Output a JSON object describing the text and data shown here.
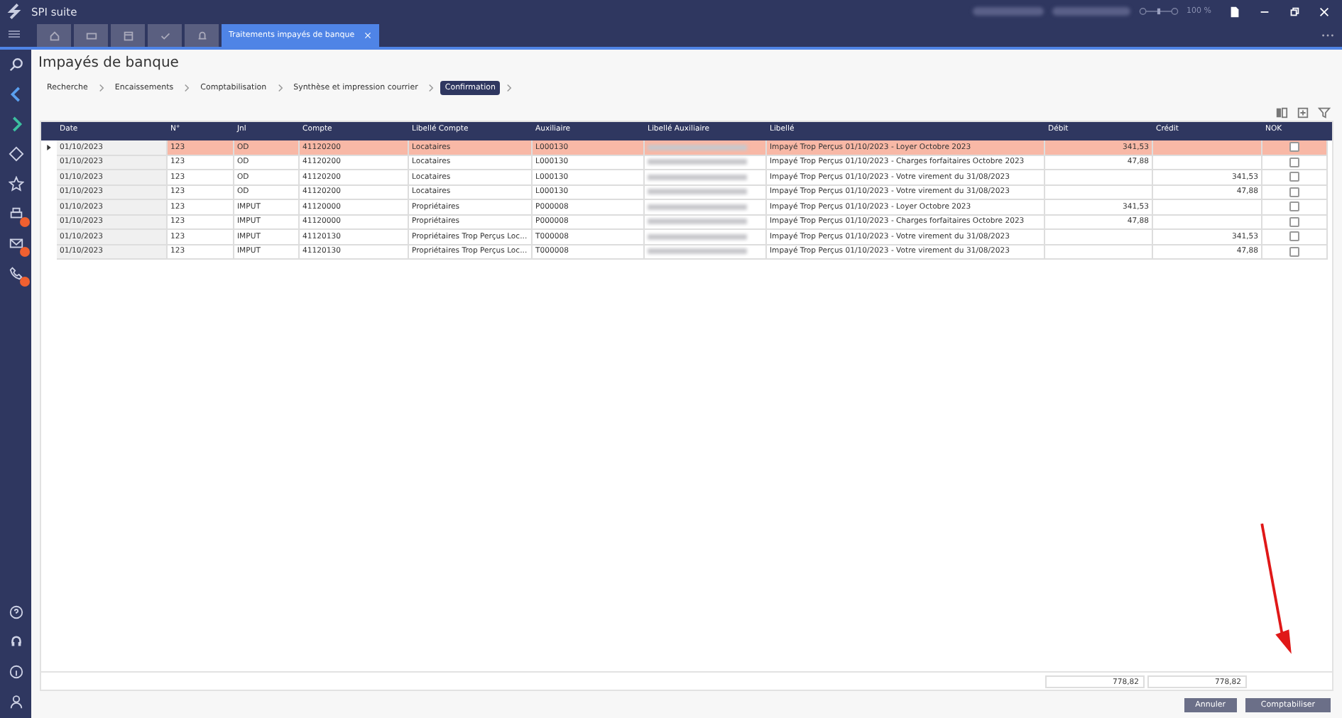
{
  "app": {
    "title": "SPI suite",
    "zoom": "100 %",
    "zoom_slider": {
      "level": 0.5
    }
  },
  "tabs": [
    {
      "kind": "home",
      "selected": false
    },
    {
      "kind": "card",
      "selected": false
    },
    {
      "kind": "calendar",
      "selected": false
    },
    {
      "kind": "check",
      "selected": false
    },
    {
      "kind": "bell",
      "selected": false
    },
    {
      "kind": "text",
      "label": "Traitements impayés de banque",
      "selected": true
    }
  ],
  "sidebar": [
    {
      "kind": "search",
      "badge": false
    },
    {
      "kind": "back",
      "badge": false
    },
    {
      "kind": "forward",
      "badge": false
    },
    {
      "kind": "diamond",
      "badge": false
    },
    {
      "kind": "star",
      "badge": false
    },
    {
      "kind": "printer",
      "badge": true
    },
    {
      "kind": "mail",
      "badge": true
    },
    {
      "kind": "phone",
      "badge": true
    }
  ],
  "sidebar_bottom": [
    {
      "kind": "help"
    },
    {
      "kind": "headset"
    },
    {
      "kind": "info"
    },
    {
      "kind": "user"
    }
  ],
  "page_title": "Impayés de banque",
  "steps": [
    {
      "label": "Recherche",
      "selected": false
    },
    {
      "label": "Encaissements",
      "selected": false
    },
    {
      "label": "Comptabilisation",
      "selected": false
    },
    {
      "label": "Synthèse et impression courrier",
      "selected": false
    },
    {
      "label": "Confirmation",
      "selected": true
    }
  ],
  "table": {
    "columns": [
      "Date",
      "N°",
      "Jnl",
      "Compte",
      "Libellé Compte",
      "Auxiliaire",
      "Libellé Auxiliaire",
      "Libellé",
      "Débit",
      "Crédit",
      "NOK"
    ],
    "rows": [
      {
        "selected": true,
        "cells": [
          "01/10/2023",
          "123",
          "OD",
          "41120200",
          "Locataires",
          "L000130",
          "",
          "Impayé Trop Perçus 01/10/2023 - Loyer Octobre      2023",
          "341,53",
          ""
        ],
        "nok": false
      },
      {
        "selected": false,
        "cells": [
          "01/10/2023",
          "123",
          "OD",
          "41120200",
          "Locataires",
          "L000130",
          "",
          "Impayé Trop Perçus 01/10/2023 - Charges forfaitaires Octobre      2023",
          "47,88",
          ""
        ],
        "nok": false
      },
      {
        "selected": false,
        "cells": [
          "01/10/2023",
          "123",
          "OD",
          "41120200",
          "Locataires",
          "L000130",
          "",
          "Impayé Trop Perçus 01/10/2023 - Votre virement du 31/08/2023",
          "",
          "341,53"
        ],
        "nok": false
      },
      {
        "selected": false,
        "cells": [
          "01/10/2023",
          "123",
          "OD",
          "41120200",
          "Locataires",
          "L000130",
          "",
          "Impayé Trop Perçus 01/10/2023 - Votre virement du 31/08/2023",
          "",
          "47,88"
        ],
        "nok": false
      },
      {
        "selected": false,
        "cells": [
          "01/10/2023",
          "123",
          "IMPUT",
          "41120000",
          "Propriétaires",
          "P000008",
          "",
          "Impayé Trop Perçus 01/10/2023 - Loyer Octobre      2023",
          "341,53",
          ""
        ],
        "nok": false
      },
      {
        "selected": false,
        "cells": [
          "01/10/2023",
          "123",
          "IMPUT",
          "41120000",
          "Propriétaires",
          "P000008",
          "",
          "Impayé Trop Perçus 01/10/2023 - Charges forfaitaires Octobre      2023",
          "47,88",
          ""
        ],
        "nok": false
      },
      {
        "selected": false,
        "cells": [
          "01/10/2023",
          "123",
          "IMPUT",
          "41120130",
          "Propriétaires Trop Perçus Loc...",
          "T000008",
          "",
          "Impayé Trop Perçus 01/10/2023 - Votre virement du 31/08/2023",
          "",
          "341,53"
        ],
        "nok": false
      },
      {
        "selected": false,
        "cells": [
          "01/10/2023",
          "123",
          "IMPUT",
          "41120130",
          "Propriétaires Trop Perçus Loc...",
          "T000008",
          "",
          "Impayé Trop Perçus 01/10/2023 - Votre virement du 31/08/2023",
          "",
          "47,88"
        ],
        "nok": false
      }
    ],
    "totals": [
      "778,82",
      "778,82"
    ]
  },
  "buttons": [
    "Annuler",
    "Comptabiliser"
  ]
}
